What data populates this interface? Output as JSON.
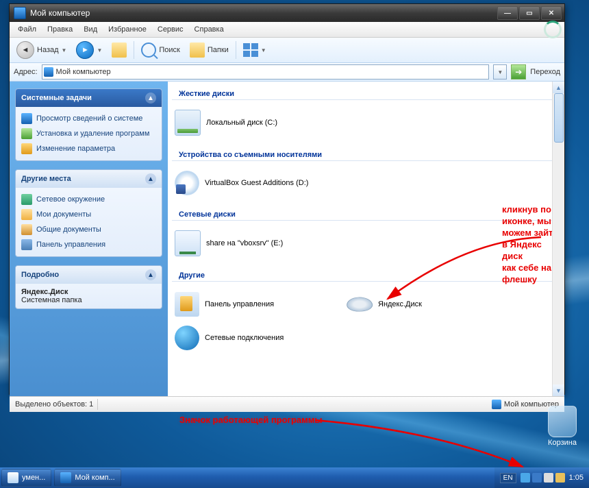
{
  "window": {
    "title": "Мой компьютер",
    "menu": {
      "file": "Файл",
      "edit": "Правка",
      "view": "Вид",
      "favorites": "Избранное",
      "tools": "Сервис",
      "help": "Справка"
    },
    "toolbar": {
      "back": "Назад",
      "search": "Поиск",
      "folders": "Папки"
    },
    "address": {
      "label": "Адрес:",
      "value": "Мой компьютер",
      "go": "Переход"
    },
    "status": {
      "selection": "Выделено объектов: 1",
      "location": "Мой компьютер"
    }
  },
  "sidebar": {
    "tasks": {
      "title": "Системные задачи",
      "items": [
        "Просмотр сведений о системе",
        "Установка и удаление программ",
        "Изменение параметра"
      ]
    },
    "places": {
      "title": "Другие места",
      "items": [
        "Сетевое окружение",
        "Мои документы",
        "Общие документы",
        "Панель управления"
      ]
    },
    "details": {
      "title": "Подробно",
      "name": "Яндекс.Диск",
      "type": "Системная папка"
    }
  },
  "content": {
    "cat_hdd": "Жесткие диски",
    "hdd": "Локальный диск (C:)",
    "cat_removable": "Устройства со съемными носителями",
    "removable": "VirtualBox Guest Additions (D:)",
    "cat_net": "Сетевые диски",
    "net": "share на \"vboxsrv\" (E:)",
    "cat_other": "Другие",
    "cp": "Панель управления",
    "yd": "Яндекс.Диск",
    "netconn": "Сетевые подключения"
  },
  "annot": {
    "a1_l1": "кликнув по иконке, мы",
    "a1_l2": "можем зайти в Яндекс диск",
    "a1_l3": "как себе на флешку",
    "a2": "Значок работающей программы"
  },
  "desktop": {
    "recycle": "Корзина"
  },
  "taskbar": {
    "btn1": "умен...",
    "btn2": "Мой комп...",
    "lang": "EN",
    "time": "1:05"
  }
}
